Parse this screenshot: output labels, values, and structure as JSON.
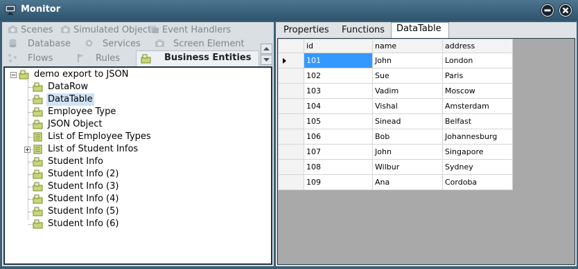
{
  "window": {
    "title": "Monitor",
    "app_icon": "monitor-icon",
    "minimize_icon": "minimize-icon",
    "close_icon": "close-icon"
  },
  "left_tabs": [
    {
      "label": "Scenes",
      "icon": "camera-icon"
    },
    {
      "label": "Simulated Objects",
      "icon": "camera-icon"
    },
    {
      "label": "Event Handlers",
      "icon": "event-icon"
    },
    {
      "label": "Database",
      "icon": "database-icon"
    },
    {
      "label": "Services",
      "icon": "gear-icon"
    },
    {
      "label": "Screen Element",
      "icon": "camera-icon"
    },
    {
      "label": "Flows",
      "icon": "flow-icon"
    },
    {
      "label": "Rules",
      "icon": "flag-icon"
    },
    {
      "label": "Business Entities",
      "icon": "entity-icon",
      "active": true
    }
  ],
  "tree": {
    "root": "demo export to JSON",
    "items": [
      {
        "label": "DataRow",
        "icon": "entity-icon"
      },
      {
        "label": "DataTable",
        "icon": "entity-icon",
        "selected": true
      },
      {
        "label": "Employee Type",
        "icon": "entity-icon"
      },
      {
        "label": "JSON Object",
        "icon": "entity-icon"
      },
      {
        "label": "List of Employee Types",
        "icon": "list-icon"
      },
      {
        "label": "List of Student Infos",
        "icon": "list-icon",
        "expandable": true
      },
      {
        "label": "Student Info",
        "icon": "entity-icon"
      },
      {
        "label": "Student Info (2)",
        "icon": "entity-icon"
      },
      {
        "label": "Student Info (3)",
        "icon": "entity-icon"
      },
      {
        "label": "Student Info (4)",
        "icon": "entity-icon"
      },
      {
        "label": "Student Info (5)",
        "icon": "entity-icon"
      },
      {
        "label": "Student Info (6)",
        "icon": "entity-icon"
      }
    ]
  },
  "right_tabs": [
    {
      "label": "Properties"
    },
    {
      "label": "Functions"
    },
    {
      "label": "DataTable",
      "active": true
    }
  ],
  "grid": {
    "columns": [
      "id",
      "name",
      "address"
    ],
    "rows": [
      [
        "101",
        "John",
        "London"
      ],
      [
        "102",
        "Sue",
        "Paris"
      ],
      [
        "103",
        "Vadim",
        "Moscow"
      ],
      [
        "104",
        "Vishal",
        "Amsterdam"
      ],
      [
        "105",
        "Sinead",
        "Belfast"
      ],
      [
        "106",
        "Bob",
        "Johannesburg"
      ],
      [
        "107",
        "John",
        "Singapore"
      ],
      [
        "108",
        "Wilbur",
        "Sydney"
      ],
      [
        "109",
        "Ana",
        "Cordoba"
      ]
    ],
    "selected_row": 0
  },
  "colors": {
    "titlebar": "#3c5f78",
    "selection": "#3399ff",
    "tree_selection": "#cfe3f7",
    "grid_background": "#a9a9a9"
  }
}
